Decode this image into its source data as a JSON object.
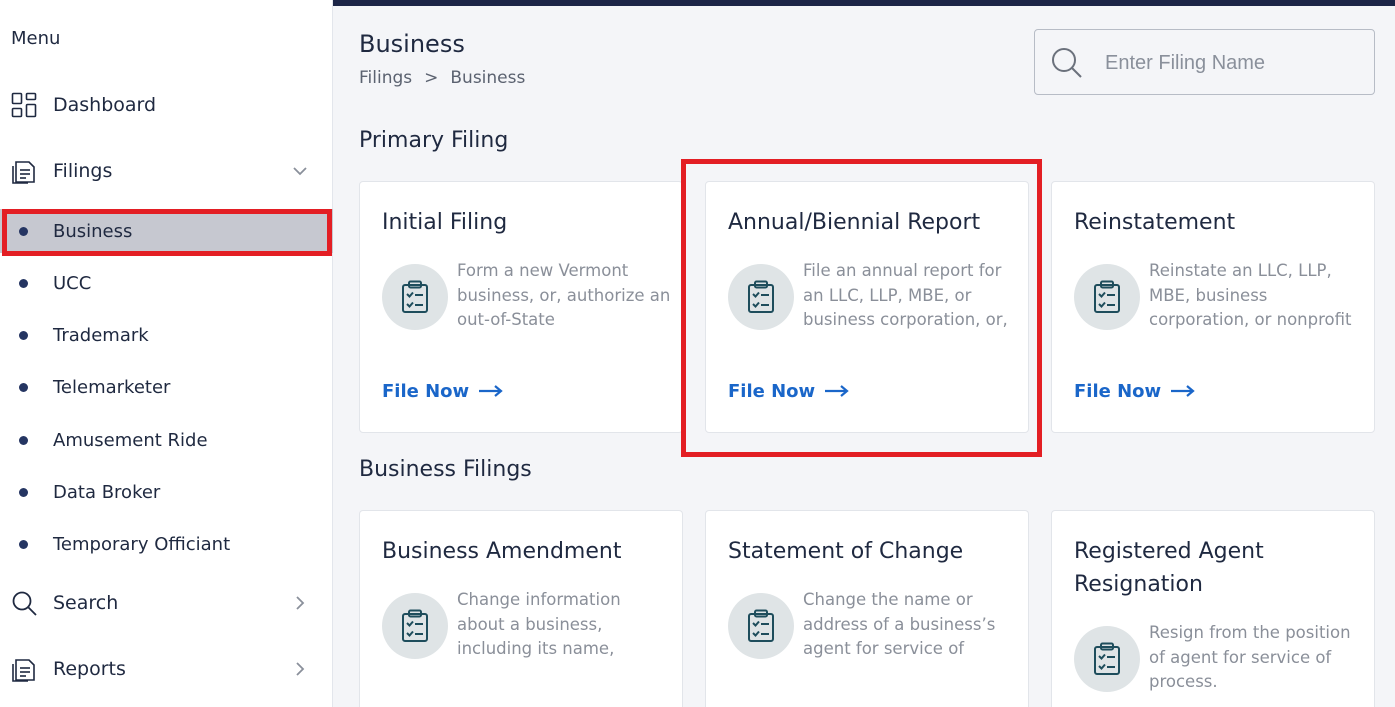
{
  "sidebar": {
    "heading": "Menu",
    "dashboard": "Dashboard",
    "filings": "Filings",
    "filings_sub": [
      "Business",
      "UCC",
      "Trademark",
      "Telemarketer",
      "Amusement Ride",
      "Data Broker",
      "Temporary Officiant"
    ],
    "search": "Search",
    "reports": "Reports"
  },
  "header": {
    "title": "Business",
    "breadcrumb": [
      "Filings",
      ">",
      "Business"
    ],
    "search_placeholder": "Enter Filing Name"
  },
  "sections": {
    "primary": "Primary Filing",
    "business": "Business Filings"
  },
  "primary_cards": [
    {
      "title": "Initial Filing",
      "desc": "Form a new Vermont business, or, authorize an out-of-State",
      "link": "File Now"
    },
    {
      "title": "Annual/Biennial Report",
      "desc": "File an annual report for an LLC, LLP, MBE, or business corporation, or,",
      "link": "File Now"
    },
    {
      "title": "Reinstatement",
      "desc": "Reinstate an LLC, LLP, MBE, business corporation, or nonprofit",
      "link": "File Now"
    }
  ],
  "business_cards": [
    {
      "title": "Business Amendment",
      "desc": "Change information about a business, including its name,"
    },
    {
      "title": "Statement of Change",
      "desc": "Change the name or address of a business’s agent for service of"
    },
    {
      "title": "Registered Agent Resignation",
      "desc": "Resign from the position of agent for service of process."
    }
  ],
  "colors": {
    "accent": "#1a66c9",
    "navy": "#1c2547",
    "highlight": "#e31e24",
    "icon_bg": "#dfe4e6"
  }
}
